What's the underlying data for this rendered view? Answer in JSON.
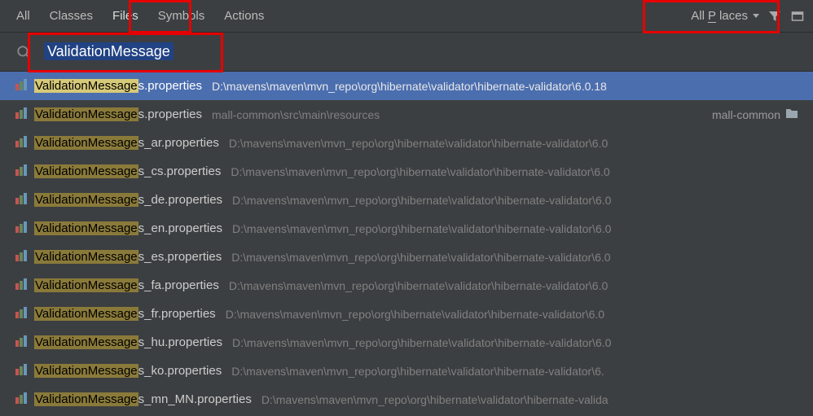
{
  "tabs": {
    "all": "All",
    "classes": "Classes",
    "files": "Files",
    "symbols": "Symbols",
    "actions": "Actions"
  },
  "scope": {
    "pre": "All ",
    "u": "P",
    "post": "laces"
  },
  "search": {
    "query": "ValidationMessage"
  },
  "repo_path": "D:\\mavens\\maven\\mvn_repo\\org\\hibernate\\validator\\hibernate-validator\\6.0.18",
  "repo_path_trim": "D:\\mavens\\maven\\mvn_repo\\org\\hibernate\\validator\\hibernate-validator\\6.0",
  "repo_path_trim2": "D:\\mavens\\maven\\mvn_repo\\org\\hibernate\\validator\\hibernate-validator\\6.",
  "repo_path_mn": "D:\\mavens\\maven\\mvn_repo\\org\\hibernate\\validator\\hibernate-valida",
  "results": [
    {
      "pre": "",
      "hl": "ValidationMessage",
      "post": "s.properties",
      "path_key": "repo_path",
      "selected": true
    },
    {
      "pre": "",
      "hl": "ValidationMessage",
      "post": "s.properties",
      "path": "mall-common\\src\\main\\resources",
      "module": "mall-common"
    },
    {
      "pre": "",
      "hl": "ValidationMessage",
      "post": "s_ar.properties",
      "path_key": "repo_path_trim"
    },
    {
      "pre": "",
      "hl": "ValidationMessage",
      "post": "s_cs.properties",
      "path_key": "repo_path_trim"
    },
    {
      "pre": "",
      "hl": "ValidationMessage",
      "post": "s_de.properties",
      "path_key": "repo_path_trim"
    },
    {
      "pre": "",
      "hl": "ValidationMessage",
      "post": "s_en.properties",
      "path_key": "repo_path_trim"
    },
    {
      "pre": "",
      "hl": "ValidationMessage",
      "post": "s_es.properties",
      "path_key": "repo_path_trim"
    },
    {
      "pre": "",
      "hl": "ValidationMessage",
      "post": "s_fa.properties",
      "path_key": "repo_path_trim"
    },
    {
      "pre": "",
      "hl": "ValidationMessage",
      "post": "s_fr.properties",
      "path_key": "repo_path_trim"
    },
    {
      "pre": "",
      "hl": "ValidationMessage",
      "post": "s_hu.properties",
      "path_key": "repo_path_trim"
    },
    {
      "pre": "",
      "hl": "ValidationMessage",
      "post": "s_ko.properties",
      "path_key": "repo_path_trim2"
    },
    {
      "pre": "",
      "hl": "ValidationMessage",
      "post": "s_mn_MN.properties",
      "path_key": "repo_path_mn"
    }
  ]
}
